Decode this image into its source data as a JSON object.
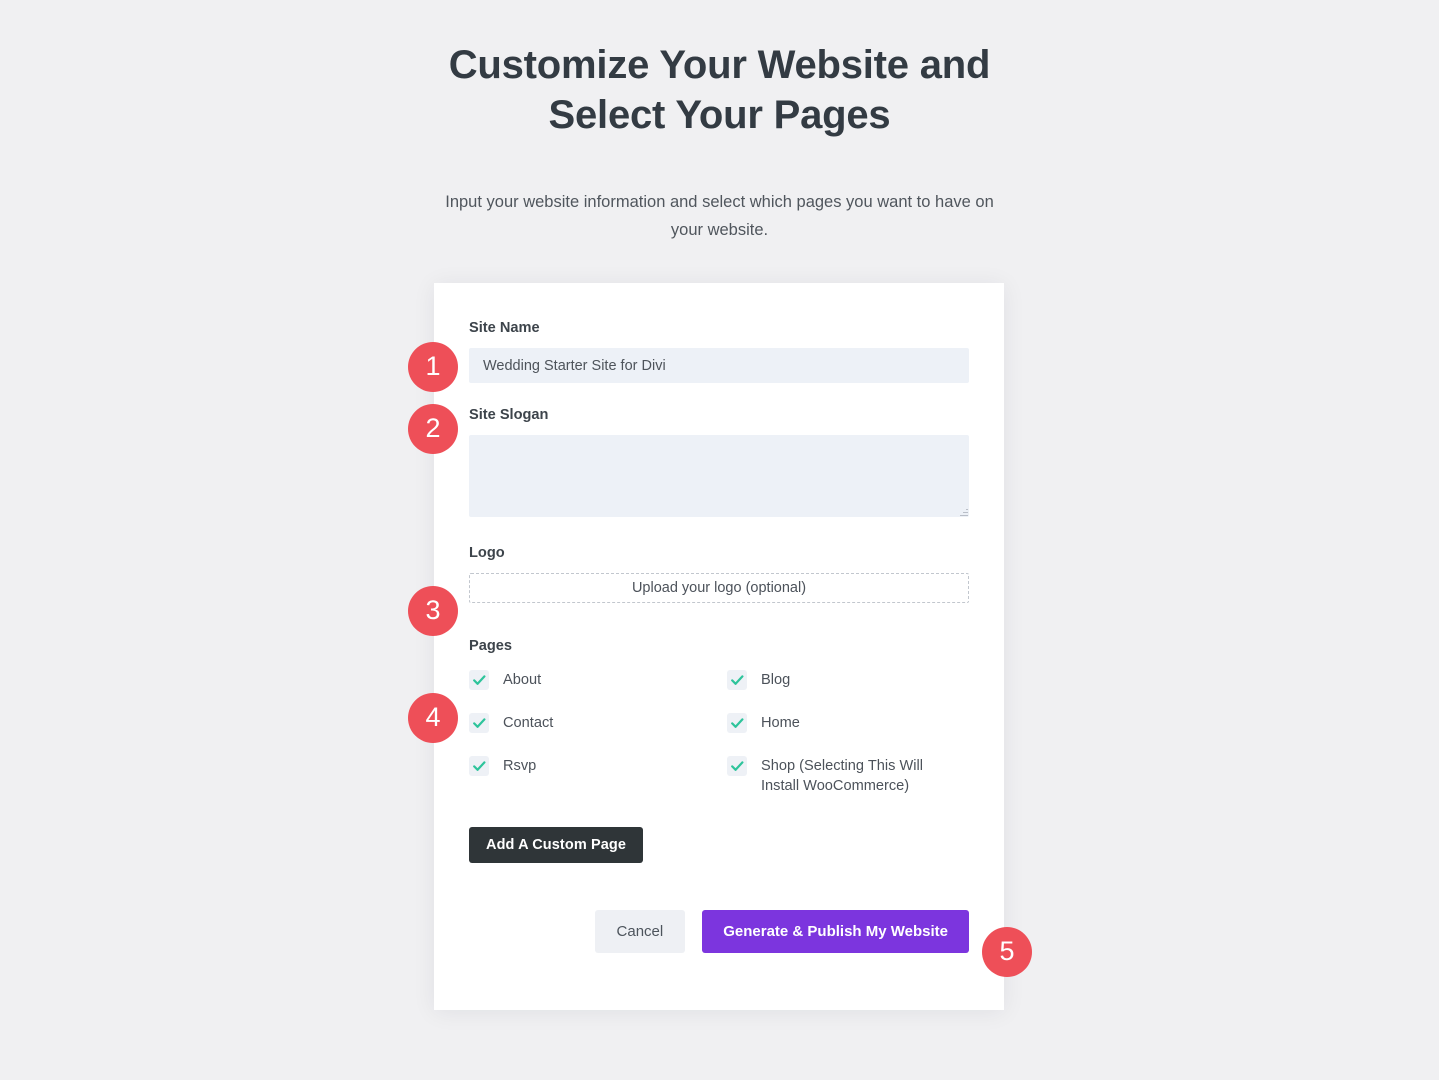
{
  "header": {
    "title": "Customize Your Website and Select Your Pages",
    "subtitle": "Input your website information and select which pages you want to have on your website."
  },
  "form": {
    "site_name": {
      "label": "Site Name",
      "value": "Wedding Starter Site for Divi",
      "placeholder": ""
    },
    "site_slogan": {
      "label": "Site Slogan",
      "value": "",
      "placeholder": ""
    },
    "logo": {
      "label": "Logo",
      "upload_text": "Upload your logo (optional)"
    },
    "pages": {
      "label": "Pages",
      "items": [
        {
          "label": "About",
          "checked": true
        },
        {
          "label": "Blog",
          "checked": true
        },
        {
          "label": "Contact",
          "checked": true
        },
        {
          "label": "Home",
          "checked": true
        },
        {
          "label": "Rsvp",
          "checked": true
        },
        {
          "label": "Shop (Selecting This Will Install WooCommerce)",
          "checked": true
        }
      ],
      "add_custom_page_label": "Add A Custom Page"
    }
  },
  "actions": {
    "cancel_label": "Cancel",
    "generate_label": "Generate & Publish My Website"
  },
  "badges": [
    {
      "number": "1"
    },
    {
      "number": "2"
    },
    {
      "number": "3"
    },
    {
      "number": "4"
    },
    {
      "number": "5"
    }
  ],
  "colors": {
    "badge": "#ee4f58",
    "primary_button": "#7c35de",
    "dark_button": "#2f3538",
    "checkmark": "#2ec49b",
    "page_background": "#f0f0f2",
    "input_background": "#edf1f7"
  }
}
